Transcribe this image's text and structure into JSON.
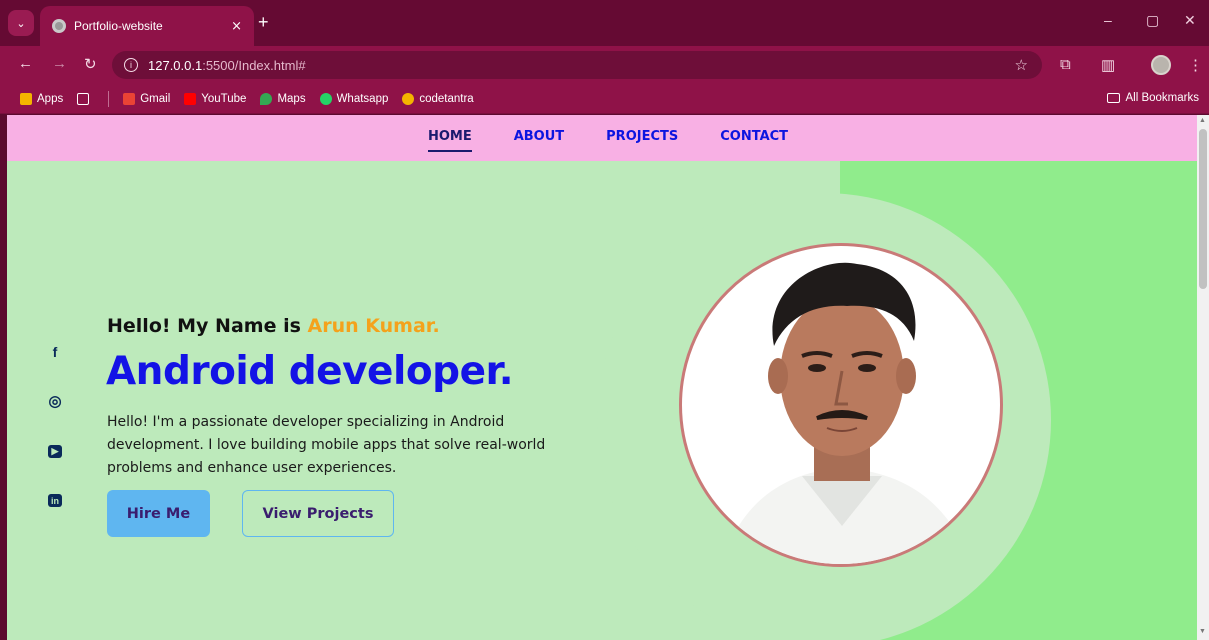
{
  "browser": {
    "tab_title": "Portfolio-website",
    "tab_close": "×",
    "new_tab": "+",
    "url_host": "127.0.0.1",
    "url_rest": ":5500/Index.html#",
    "info_glyph": "i",
    "window_controls": {
      "minimize": "–",
      "restore": "▢",
      "close": "✕"
    },
    "bookmarks": [
      {
        "label": "Apps",
        "color": "#f4b400"
      },
      {
        "label": "Gmail",
        "color": "#ea4335"
      },
      {
        "label": "YouTube",
        "color": "#ff0000"
      },
      {
        "label": "Maps",
        "color": "#34a853"
      },
      {
        "label": "Whatsapp",
        "color": "#25d366"
      },
      {
        "label": "codetantra",
        "color": "#f4b400"
      }
    ],
    "all_bookmarks": "All Bookmarks"
  },
  "nav": {
    "home": "HOME",
    "about": "ABOUT",
    "projects": "PROJECTS",
    "contact": "CONTACT"
  },
  "social": {
    "facebook": "f",
    "instagram": "◎",
    "youtube": "▶",
    "linkedin": "in"
  },
  "hero": {
    "hello_prefix": "Hello! My Name is ",
    "name": "Arun Kumar.",
    "role": "Android developer.",
    "description": "Hello! I'm a passionate developer specializing in Android development. I love building mobile apps that solve real-world problems and enhance user experiences.",
    "hire_button": "Hire Me",
    "projects_button": "View Projects"
  },
  "colors": {
    "accent_blue": "#1313e6",
    "name_orange": "#f4a21c",
    "nav_pink": "#f8b0e4",
    "bg_green": "#bdeabb",
    "panel_green": "#90ec8c",
    "button_blue": "#5fb6f0"
  }
}
